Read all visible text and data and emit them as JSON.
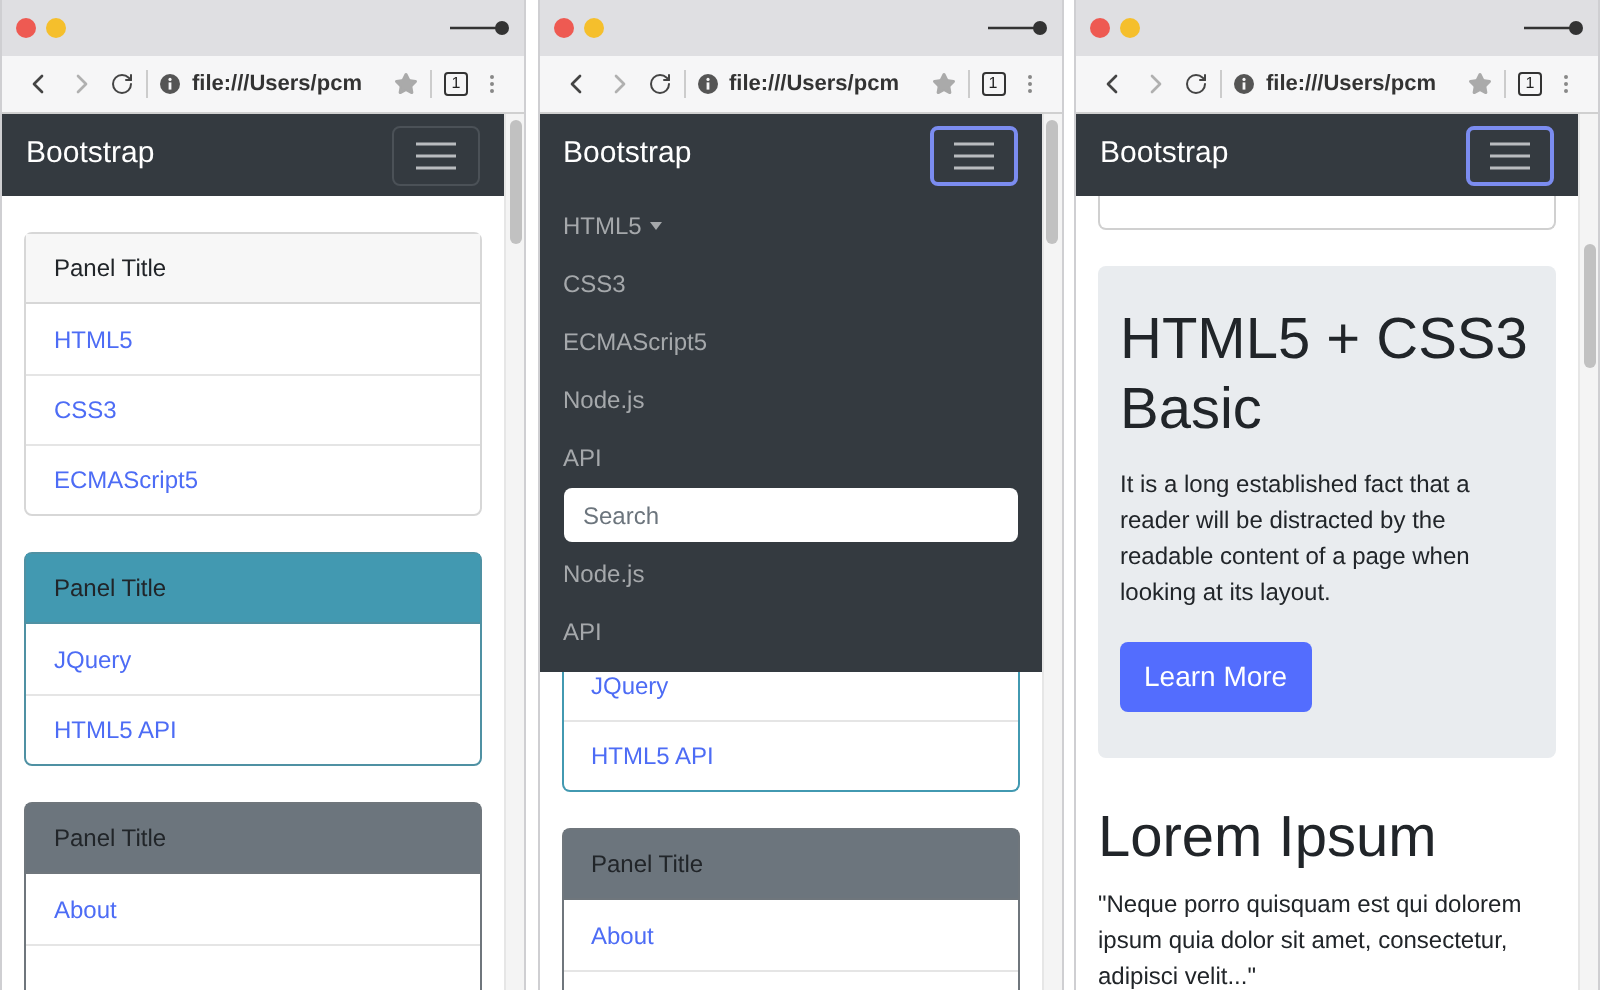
{
  "windows": [
    {
      "url": "file:///Users/pcm",
      "tab_count": "1",
      "brand": "Bootstrap",
      "toggler_focused": false,
      "content": [
        {
          "kind": "panel",
          "color": "#f7f7f7",
          "title": "Panel Title",
          "items": [
            "HTML5",
            "CSS3",
            "ECMAScript5"
          ]
        },
        {
          "kind": "panel",
          "color": "#4299b1",
          "title": "Panel Title",
          "items": [
            "JQuery",
            "HTML5 API"
          ]
        },
        {
          "kind": "panel",
          "color": "#6c757d",
          "title": "Panel Title",
          "items": [
            "About"
          ]
        }
      ]
    },
    {
      "url": "file:///Users/pcm",
      "tab_count": "1",
      "brand": "Bootstrap",
      "toggler_focused": true,
      "menu": [
        {
          "kind": "dropdown",
          "label": "HTML5"
        },
        {
          "kind": "link",
          "label": "CSS3"
        },
        {
          "kind": "link",
          "label": "ECMAScript5"
        },
        {
          "kind": "link",
          "label": "Node.js"
        },
        {
          "kind": "link",
          "label": "API"
        },
        {
          "kind": "search",
          "placeholder": "Search"
        },
        {
          "kind": "link",
          "label": "Node.js"
        },
        {
          "kind": "link",
          "label": "API"
        }
      ],
      "content": [
        {
          "kind": "panel",
          "color": "#4299b1",
          "items": [
            "JQuery",
            "HTML5 API"
          ]
        },
        {
          "kind": "panel",
          "color": "#6c757d",
          "title": "Panel Title",
          "items": [
            "About"
          ]
        }
      ]
    },
    {
      "url": "file:///Users/pcm",
      "tab_count": "1",
      "brand": "Bootstrap",
      "toggler_focused": true,
      "content": [
        {
          "kind": "panel"
        },
        {
          "kind": "jumbotron",
          "heading": "HTML5 + CSS3 Basic",
          "text": "It is a long established fact that a reader will be distracted by the readable content of a page when looking at its layout.",
          "button": "Learn More"
        },
        {
          "kind": "section",
          "heading": "Lorem Ipsum",
          "text": "\"Neque porro quisquam est qui dolorem ipsum quia dolor sit amet, consectetur, adipisci velit...\""
        }
      ]
    }
  ]
}
